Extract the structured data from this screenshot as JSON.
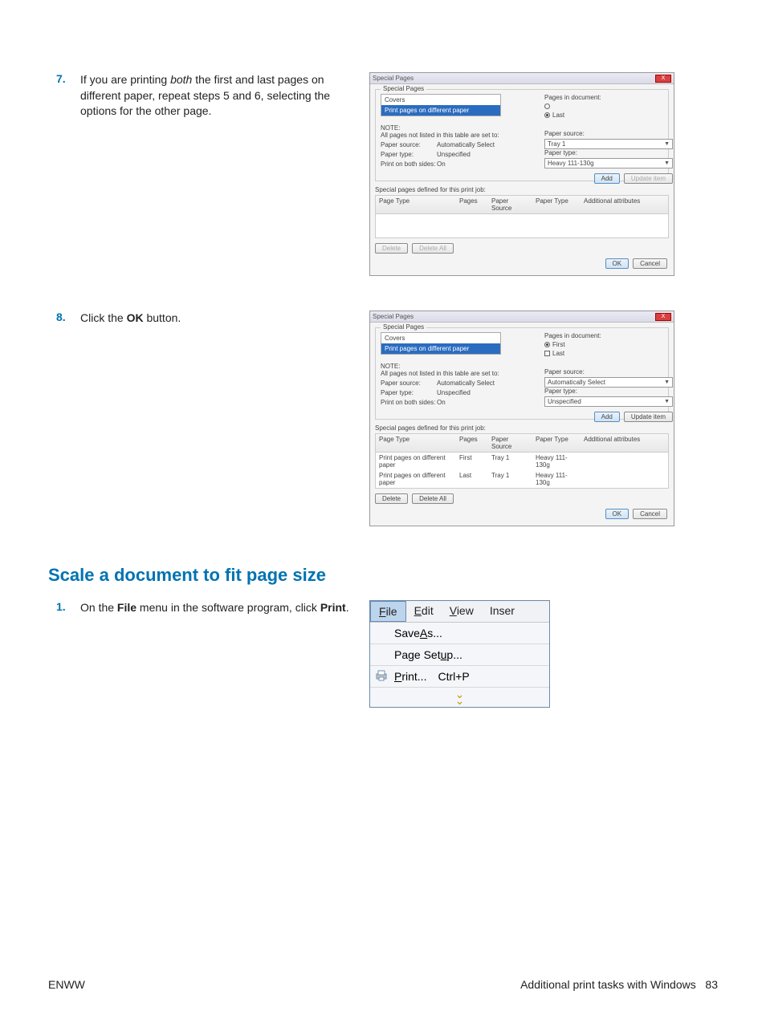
{
  "steps": {
    "s7": {
      "num": "7.",
      "text_pre": "If you are printing ",
      "both": "both",
      "text_mid": " the first and last pages on different paper, repeat steps 5 and 6, selecting the options for the other page."
    },
    "s8": {
      "num": "8.",
      "text_pre": "Click the ",
      "ok": "OK",
      "text_post": " button."
    },
    "s1": {
      "num": "1.",
      "text_pre": "On the ",
      "file": "File",
      "text_mid": " menu in the software program, click ",
      "print": "Print",
      "text_post": "."
    }
  },
  "section_heading": "Scale a document to fit page size",
  "dialog": {
    "title": "Special Pages",
    "group": "Special Pages",
    "covers": "Covers",
    "diffpaper": "Print pages on different paper",
    "note": "NOTE:",
    "note2": "All pages not listed in this table are set to:",
    "papersource": "Paper source:",
    "papertype": "Paper type:",
    "printboth": "Print on both sides:",
    "auto": "Automatically Select",
    "unspec": "Unspecified",
    "on": "On",
    "pagesindoc": "Pages in document:",
    "first": "First",
    "last": "Last",
    "tray1": "Tray 1",
    "heavy": "Heavy 111-130g",
    "add": "Add",
    "updateitem": "Update item",
    "specialdef": "Special pages defined for this print job:",
    "col_pagetype": "Page Type",
    "col_pages": "Pages",
    "col_source": "Paper Source",
    "col_ptype": "Paper Type",
    "col_attrs": "Additional attributes",
    "delete": "Delete",
    "deleteall": "Delete All",
    "ok": "OK",
    "cancel": "Cancel"
  },
  "menu": {
    "file": "File",
    "edit": "Edit",
    "view": "View",
    "insert": "Inser",
    "saveas": "Save As...",
    "pagesetup": "Page Setup...",
    "print": "Print...",
    "ctrlp": "Ctrl+P"
  },
  "footer": {
    "left": "ENWW",
    "right_text": "Additional print tasks with Windows",
    "right_num": "83"
  }
}
